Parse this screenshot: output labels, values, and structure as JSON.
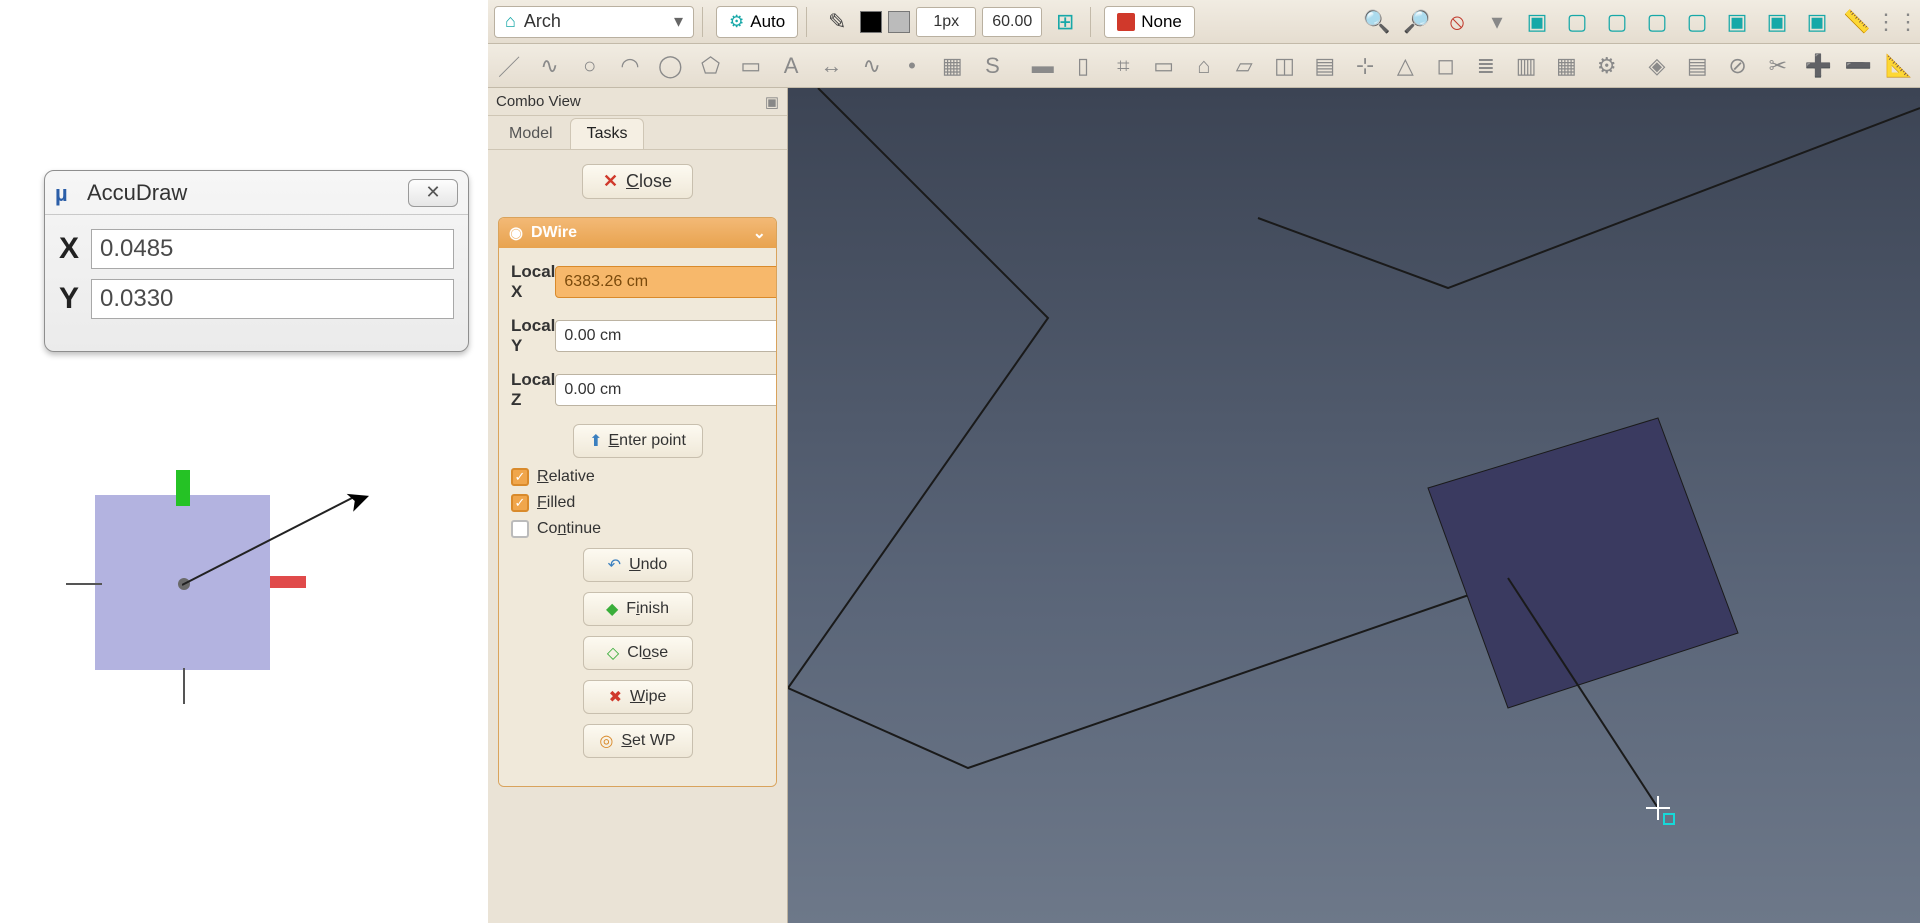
{
  "accudraw": {
    "title": "AccuDraw",
    "x_label": "X",
    "y_label": "Y",
    "x_value": "0.0485",
    "y_value": "0.0330"
  },
  "freecad": {
    "workbench": "Arch",
    "auto_label": "Auto",
    "lineweight": "1px",
    "angle": "60.00",
    "none_label": "None",
    "combo_title": "Combo View",
    "tabs": {
      "model": "Model",
      "tasks": "Tasks"
    },
    "close_label": "Close",
    "dwire": {
      "title": "DWire",
      "local_x_label": "Local X",
      "local_y_label": "Local Y",
      "local_z_label": "Local Z",
      "local_x_value": "6383.26 cm",
      "local_y_value": "0.00 cm",
      "local_z_value": "0.00 cm",
      "enter_point": "Enter point",
      "relative": "Relative",
      "filled": "Filled",
      "continue": "Continue",
      "undo": "Undo",
      "finish": "Finish",
      "close": "Close",
      "wipe": "Wipe",
      "set_wp": "Set WP"
    }
  }
}
